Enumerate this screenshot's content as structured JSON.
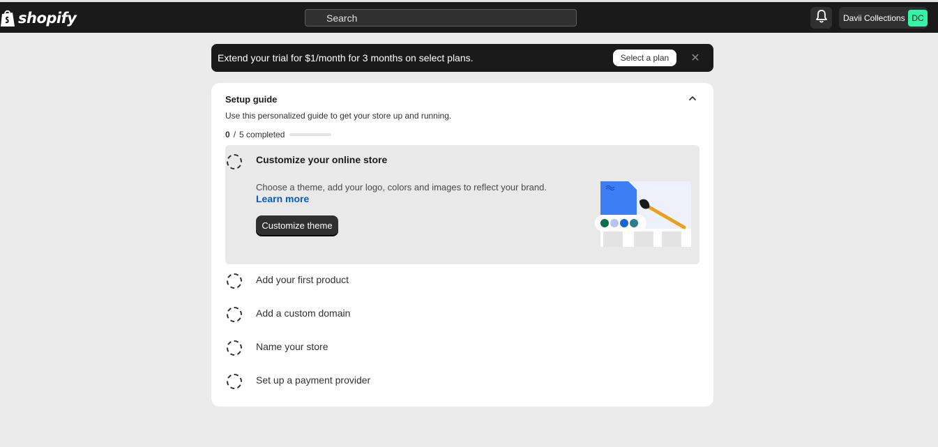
{
  "topbar": {
    "brand": "shopify",
    "search_placeholder": "Search",
    "store_name": "Davii Collections",
    "avatar_initials": "DC"
  },
  "banner": {
    "text": "Extend your trial for $1/month for 3 months on select plans.",
    "button_label": "Select a plan",
    "close_label": "✕"
  },
  "setup_guide": {
    "title": "Setup guide",
    "subtitle": "Use this personalized guide to get your store up and running.",
    "progress_done": "0",
    "progress_sep": "/",
    "progress_rest": "5 completed",
    "active_task": {
      "title": "Customize your online store",
      "description": "Choose a theme, add your logo, colors and images to reflect your brand.",
      "link": "Learn more",
      "button": "Customize theme"
    },
    "tasks": [
      {
        "label": "Add your first product"
      },
      {
        "label": "Add a custom domain"
      },
      {
        "label": "Name your store"
      },
      {
        "label": "Set up a payment provider"
      }
    ]
  },
  "colors": {
    "topbar_bg": "#1a1a1a",
    "accent_link": "#005bd3",
    "avatar_bg": "#36f1a8"
  }
}
